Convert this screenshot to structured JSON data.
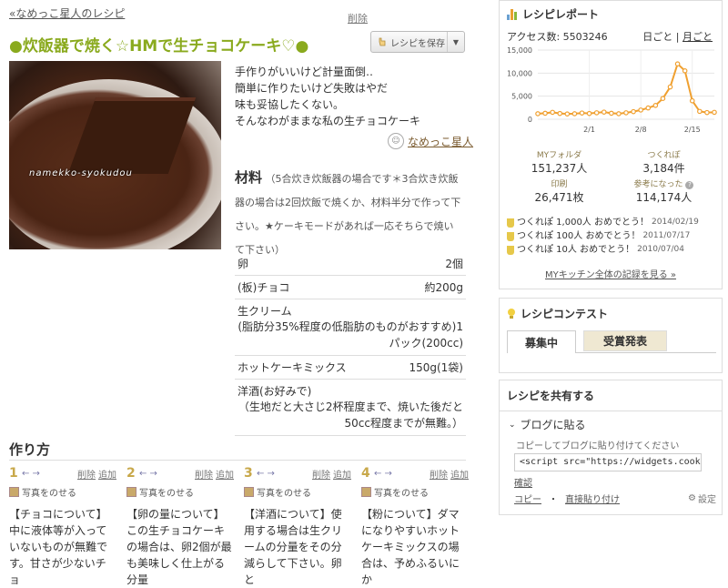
{
  "header": {
    "back_link": "«なめっこ星人のレシピ",
    "delete": "削除",
    "title": "●炊飯器で焼く☆HMで生チョコケーキ♡●",
    "save_button": "レシピを保存"
  },
  "photo": {
    "watermark": "namekko-syokudou"
  },
  "description": [
    "手作りがいいけど計量面倒‥",
    "簡単に作りたいけど失敗はやだ",
    "味も妥協したくない。",
    "そんなわがままな私の生チョコケーキ"
  ],
  "author": "なめっこ星人",
  "ingredients": {
    "heading": "材料",
    "note": "（5合炊き炊飯器の場合です＊3合炊き炊飯器の場合は2回炊飯で焼くか、材料半分で作って下さい。★ケーキモードがあれば一応そちらで焼いて下さい）",
    "items": [
      {
        "name": "卵",
        "amount": "2個",
        "detail": ""
      },
      {
        "name": "(板)チョコ",
        "amount": "約200g",
        "detail": ""
      },
      {
        "name": "生クリーム",
        "amount": "",
        "detail": "(脂肪分35%程度の低脂肪のものがおすすめ)1パック(200cc)"
      },
      {
        "name": "ホットケーキミックス",
        "amount": "150g(1袋)",
        "detail": ""
      },
      {
        "name": "洋酒(お好みで)",
        "amount": "",
        "detail": "（生地だと大さじ2杯程度まで、焼いた後だと50cc程度までが無難。）"
      }
    ]
  },
  "steps": {
    "title": "作り方",
    "arrows": "← →",
    "delete": "削除",
    "add": "追加",
    "photo_label": "写真をのせる",
    "items": [
      {
        "num": "1",
        "text": "【チョコについて】中に液体等が入っていないものが無難です。甘さが少ないチョ"
      },
      {
        "num": "2",
        "text": "【卵の量について】この生チョコケーキの場合は、卵2個が最も美味しく仕上がる分量"
      },
      {
        "num": "3",
        "text": "【洋酒について】使用する場合は生クリームの分量をその分減らして下さい。卵と"
      },
      {
        "num": "4",
        "text": "【粉について】ダマになりやすいホットケーキミックスの場合は、予めふるいにか"
      }
    ]
  },
  "report": {
    "title": "レシピレポート",
    "access": "アクセス数: 5503246",
    "daily": "日ごと",
    "sep": "|",
    "monthly": "月ごと",
    "stats": [
      {
        "label": "MYフォルダ",
        "value": "151,237人"
      },
      {
        "label": "つくれぽ",
        "value": "3,184件"
      },
      {
        "label": "印刷",
        "value": "26,471枚"
      },
      {
        "label": "参考になった",
        "value": "114,174人"
      }
    ],
    "awards": [
      {
        "text": "つくれぽ 1,000人 おめでとう！",
        "date": "2014/02/19"
      },
      {
        "text": "つくれぽ 100人 おめでとう！",
        "date": "2011/07/17"
      },
      {
        "text": "つくれぽ 10人 おめでとう！",
        "date": "2010/07/04"
      }
    ],
    "mykitchen": "MYキッチン全体の記録を見る »"
  },
  "chart_data": {
    "type": "line",
    "title": "",
    "xlabel": "",
    "ylabel": "",
    "ylim": [
      0,
      15000
    ],
    "yticks": [
      "0",
      "5,000",
      "10,000",
      "15,000"
    ],
    "xticks": [
      "2/1",
      "2/8",
      "2/15"
    ],
    "x": [
      1,
      2,
      3,
      4,
      5,
      6,
      7,
      8,
      9,
      10,
      11,
      12,
      13,
      14,
      15,
      16,
      17,
      18,
      19,
      20,
      21,
      22,
      23,
      24,
      25
    ],
    "values": [
      1200,
      1300,
      1500,
      1250,
      1150,
      1200,
      1350,
      1250,
      1400,
      1550,
      1300,
      1200,
      1400,
      1650,
      2000,
      2450,
      3000,
      4500,
      7000,
      12000,
      10500,
      4000,
      1700,
      1450,
      1500
    ],
    "grid": true,
    "line_color": "#f0a030"
  },
  "contest": {
    "title": "レシピコンテスト",
    "tabs": [
      "募集中",
      "受賞発表"
    ]
  },
  "share": {
    "title": "レシピを共有する",
    "blog": "ブログに貼る",
    "hint": "コピーしてブログに貼り付けてください",
    "code": "<script src=\"https://widgets.cookpad.com",
    "confirm": "確認",
    "copy": "コピー",
    "dot": "・",
    "direct": "直接貼り付け",
    "settings": "設定"
  },
  "colors": {
    "title_green": "#8aaa1e",
    "chart_orange": "#f0a030",
    "tab_beige": "#efe8d2"
  }
}
